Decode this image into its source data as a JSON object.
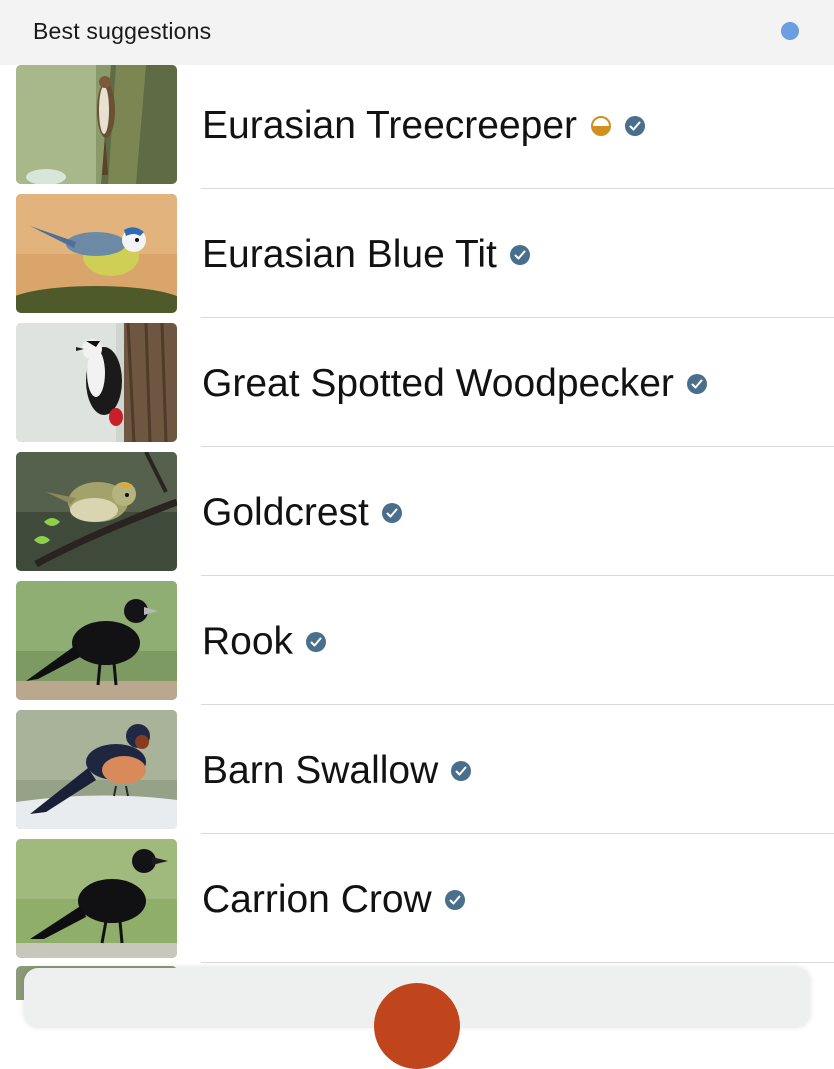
{
  "header": {
    "title": "Best suggestions",
    "status_dot_color": "#6a9ee0"
  },
  "suggestions": [
    {
      "name": "Eurasian Treecreeper",
      "badges": [
        "half-circle-icon",
        "verified-check-icon"
      ],
      "thumbnail": "treecreeper-photo"
    },
    {
      "name": "Eurasian Blue Tit",
      "badges": [
        "verified-check-icon"
      ],
      "thumbnail": "blue-tit-photo"
    },
    {
      "name": "Great Spotted Woodpecker",
      "badges": [
        "verified-check-icon"
      ],
      "thumbnail": "woodpecker-photo"
    },
    {
      "name": "Goldcrest",
      "badges": [
        "verified-check-icon"
      ],
      "thumbnail": "goldcrest-photo"
    },
    {
      "name": "Rook",
      "badges": [
        "verified-check-icon"
      ],
      "thumbnail": "rook-photo"
    },
    {
      "name": "Barn Swallow",
      "badges": [
        "verified-check-icon"
      ],
      "thumbnail": "barn-swallow-photo"
    },
    {
      "name": "Carrion Crow",
      "badges": [
        "verified-check-icon"
      ],
      "thumbnail": "carrion-crow-photo"
    }
  ],
  "colors": {
    "verified_badge": "#4a6f8c",
    "half_badge": "#d18f1f",
    "capture_button": "#c0441c"
  }
}
